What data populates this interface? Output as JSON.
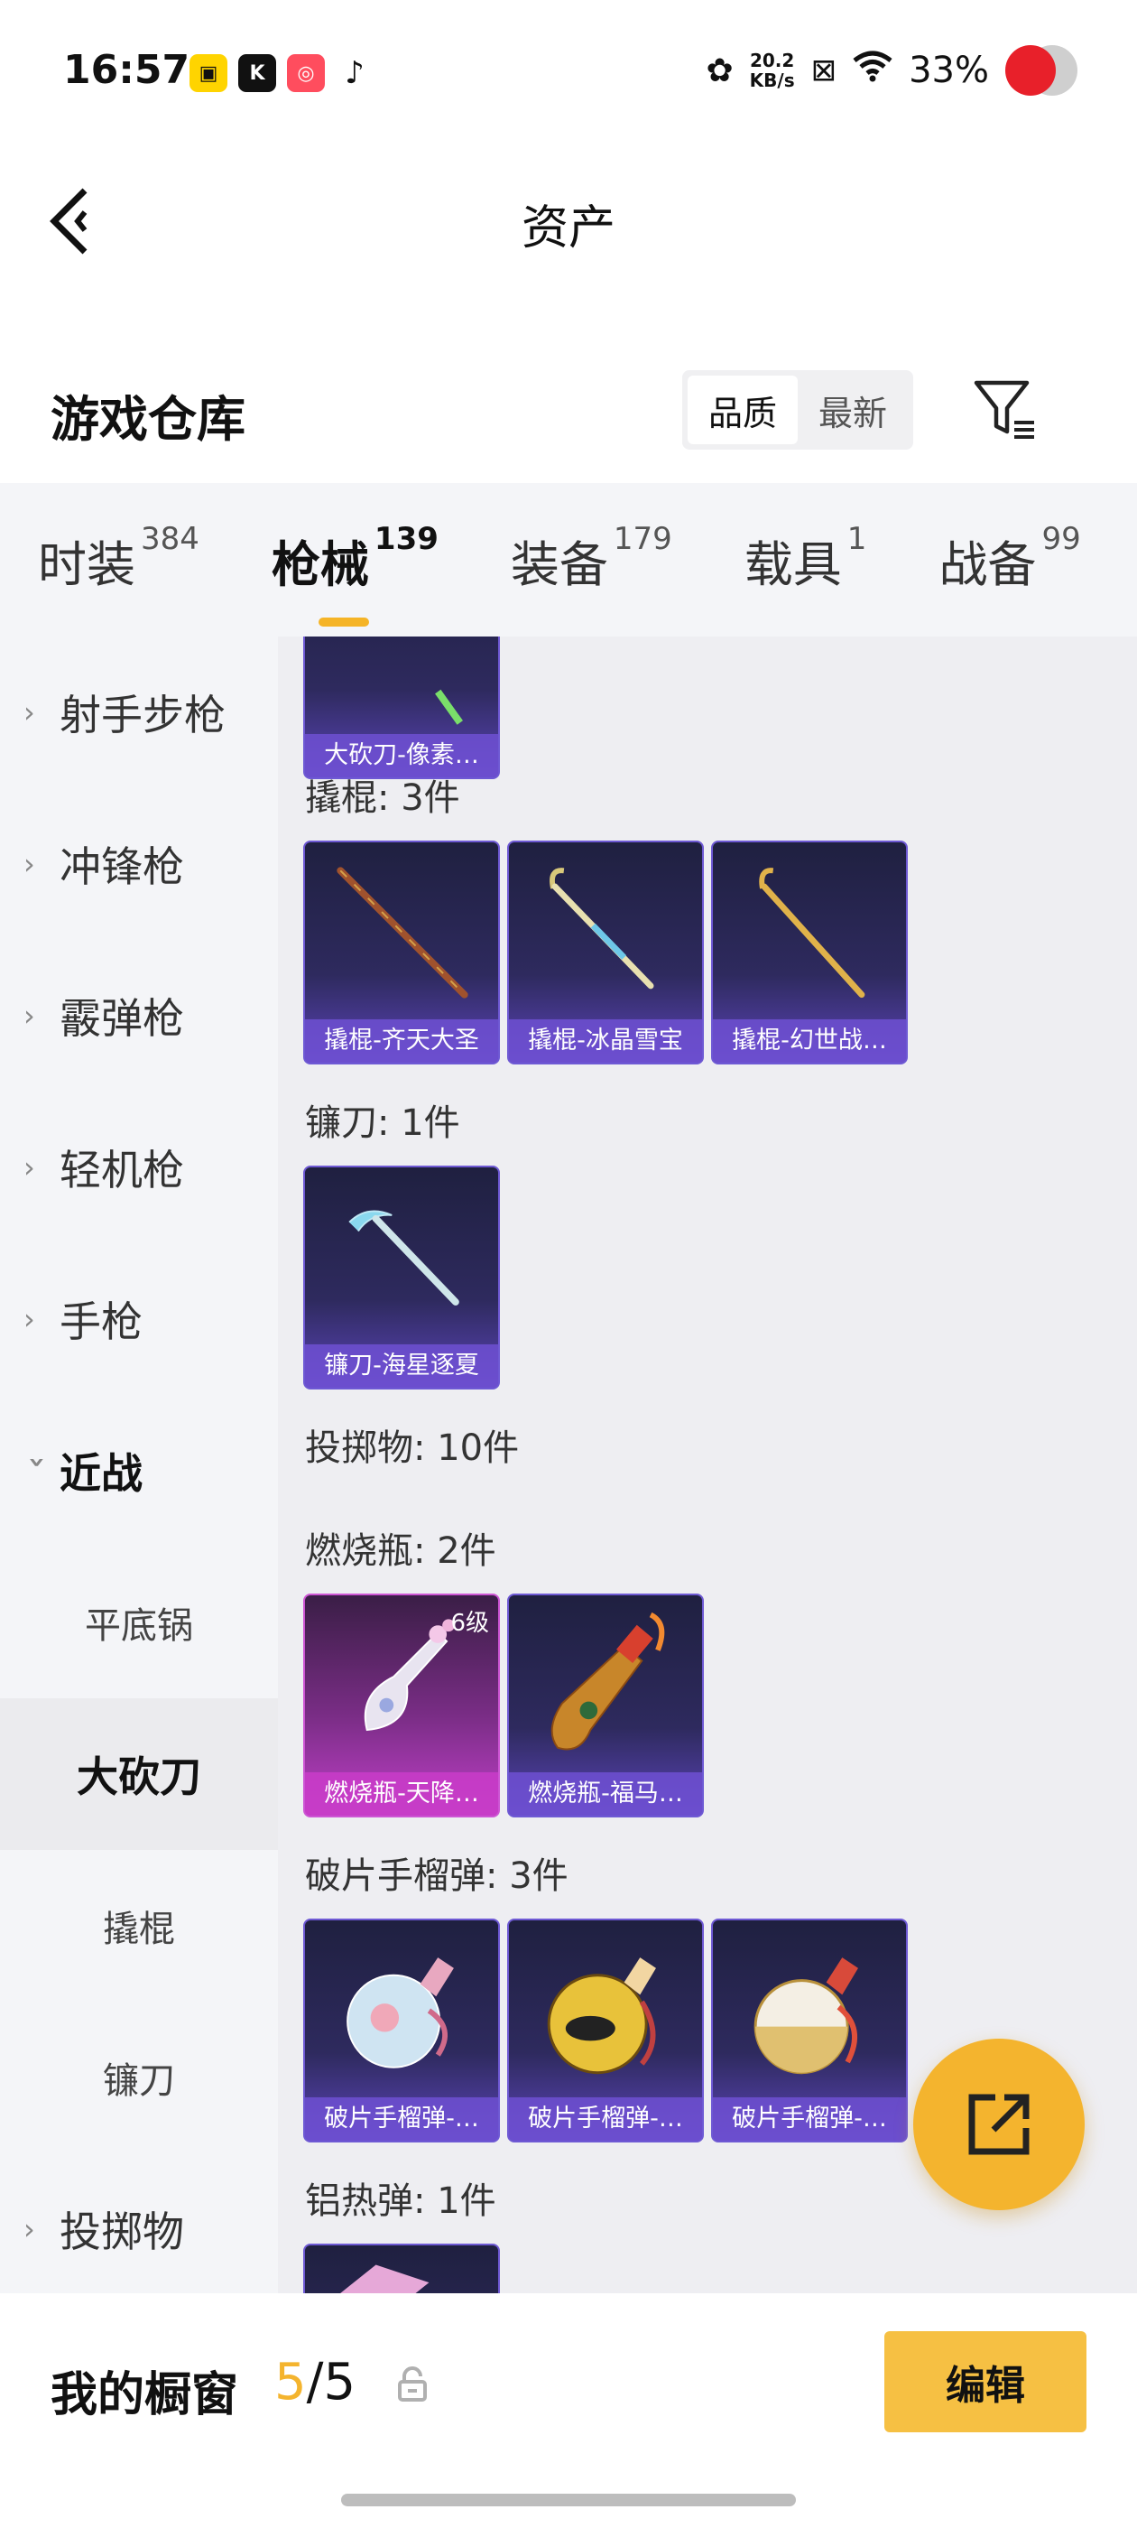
{
  "status_bar": {
    "time": "16:57",
    "net_speed_value": "20.2",
    "net_speed_unit": "KB/s",
    "battery": "33%",
    "app_icons": [
      "box-app-icon",
      "k-app-icon",
      "kuaishou-app-icon",
      "tiktok-app-icon"
    ]
  },
  "nav": {
    "title": "资产",
    "back_icon": "chevron-left-icon"
  },
  "warehouse": {
    "title": "游戏仓库",
    "sort_options": [
      "品质",
      "最新"
    ],
    "sort_selected": "品质",
    "filter_icon": "filter-icon"
  },
  "tabs": [
    {
      "label": "时装",
      "count": "384"
    },
    {
      "label": "枪械",
      "count": "139",
      "active": true
    },
    {
      "label": "装备",
      "count": "179"
    },
    {
      "label": "载具",
      "count": "1"
    },
    {
      "label": "战备",
      "count": "99"
    }
  ],
  "sidebar": {
    "items": [
      {
        "label": "射手步枪"
      },
      {
        "label": "冲锋枪"
      },
      {
        "label": "霰弹枪"
      },
      {
        "label": "轻机枪"
      },
      {
        "label": "手枪"
      },
      {
        "label": "近战",
        "expanded": true
      }
    ],
    "subitems": [
      {
        "label": "平底锅"
      },
      {
        "label": "大砍刀",
        "active": true
      },
      {
        "label": "撬棍"
      },
      {
        "label": "镰刀"
      }
    ],
    "after": [
      {
        "label": "投掷物"
      }
    ]
  },
  "main": {
    "top_card": {
      "name": "大砍刀-像素…"
    },
    "groups": {
      "crowbar": {
        "label": "撬棍: 3件",
        "items": [
          "撬棍-齐天大圣",
          "撬棍-冰晶雪宝",
          "撬棍-幻世战…"
        ]
      },
      "sickle": {
        "label": "镰刀: 1件",
        "items": [
          "镰刀-海星逐夏"
        ]
      },
      "throwables": {
        "label": "投掷物: 10件"
      },
      "molotov": {
        "label": "燃烧瓶: 2件",
        "items": [
          "燃烧瓶-天降…",
          "燃烧瓶-福马…"
        ],
        "level": "6级"
      },
      "frag": {
        "label": "破片手榴弹: 3件",
        "items": [
          "破片手榴弹-…",
          "破片手榴弹-…",
          "破片手榴弹-…"
        ]
      },
      "thermite": {
        "label": "铝热弹: 1件"
      }
    }
  },
  "bottom": {
    "window_title": "我的橱窗",
    "window_current": "5",
    "window_total": "/5",
    "edit_label": "编辑"
  },
  "colors": {
    "accent": "#f4b42e",
    "card_purple": "#5b44b8",
    "card_pink": "#c040c8"
  }
}
